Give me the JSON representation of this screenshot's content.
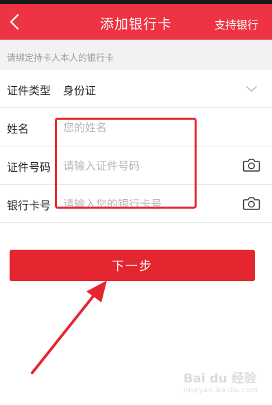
{
  "nav": {
    "title": "添加银行卡",
    "right_link": "支持银行"
  },
  "hint": "请绑定持卡人本人的银行卡",
  "form": {
    "id_type": {
      "label": "证件类型",
      "value": "身份证"
    },
    "name": {
      "label": "姓名",
      "placeholder": "您的姓名"
    },
    "id_number": {
      "label": "证件号码",
      "placeholder": "请输入证件号码"
    },
    "card_number": {
      "label": "银行卡号",
      "placeholder": "请输入您的银行卡号"
    }
  },
  "next_button": "下一步",
  "watermark": {
    "brand": "Bai du 经验",
    "url": "jingyan.baidu.com"
  },
  "colors": {
    "accent": "#ee3342",
    "annotation": "#e6262f"
  }
}
